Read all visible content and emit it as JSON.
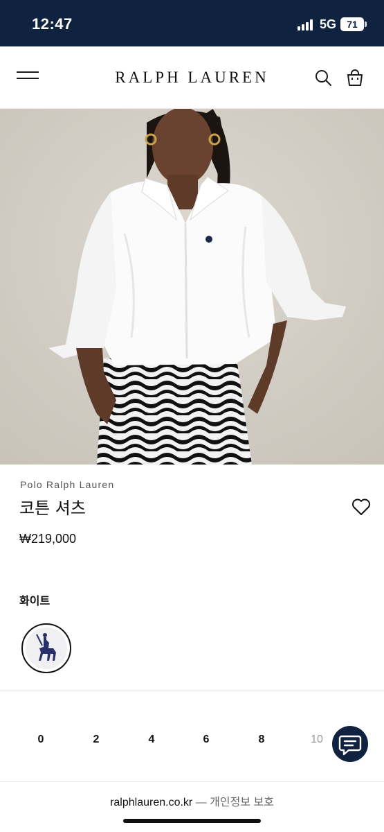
{
  "status_bar": {
    "time": "12:47",
    "network": "5G",
    "battery": "71"
  },
  "header": {
    "logo": "RALPH LAUREN",
    "icons": [
      "menu-icon",
      "search-icon",
      "shopping-bag-icon"
    ]
  },
  "hero": {
    "image": "model-in-white-shirt-photo"
  },
  "product": {
    "brand": "Polo Ralph Lauren",
    "name": "코튼 셔츠",
    "price": "₩219,000",
    "wishlist_icon": "heart-icon"
  },
  "color": {
    "label": "화이트",
    "swatch_icon": "polo-pony-icon"
  },
  "sizes": [
    "0",
    "2",
    "4",
    "6",
    "8",
    "10"
  ],
  "chat": {
    "icon": "chat-icon"
  },
  "footer": {
    "domain": "ralphlauren.co.kr",
    "separator": "—",
    "privacy": "개인정보 보호"
  },
  "colors": {
    "navy": "#0f2240",
    "text": "#111111",
    "muted": "#555555",
    "disabled": "#999999"
  }
}
